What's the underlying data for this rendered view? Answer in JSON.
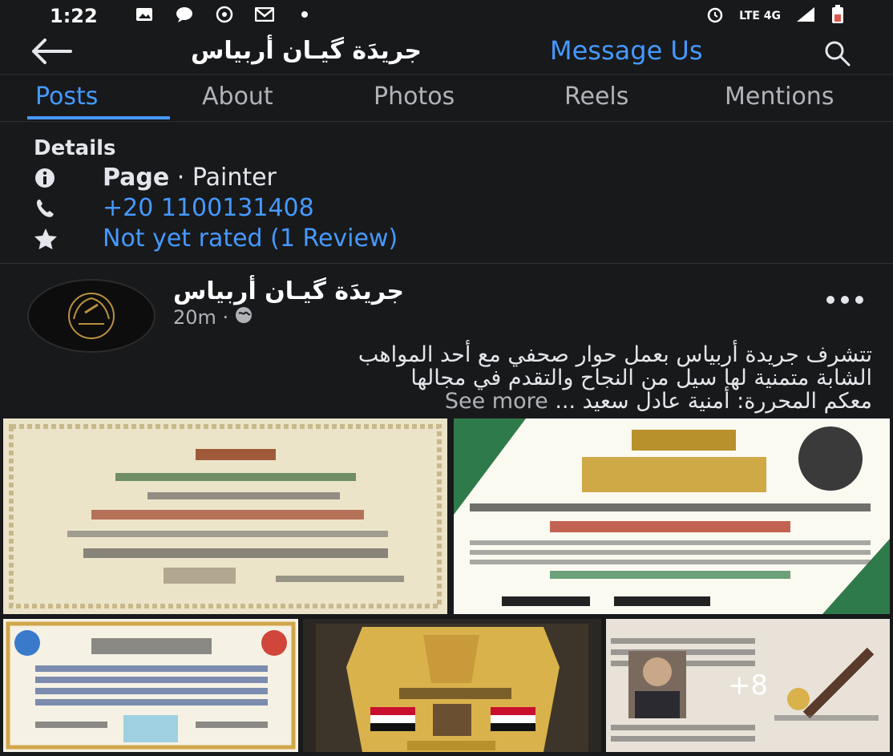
{
  "status_bar": {
    "time": "1:22",
    "right_text": "LTE 4G"
  },
  "app_bar": {
    "page_name": "جريدَة گيـان أربياس",
    "message_us": "Message Us"
  },
  "tabs": [
    "Posts",
    "About",
    "Photos",
    "Reels",
    "Mentions"
  ],
  "details": {
    "title": "Details",
    "page_bold": "Page",
    "page_category": " · Painter",
    "phone": "+20 1100131408",
    "rating": "Not yet rated (1 Review)"
  },
  "post": {
    "author": "جريدَة گيـان أربياس",
    "time": "20m ·",
    "text_line1": "تتشرف جريدة أربياس بعمل حوار صحفي مع أحد المواهب",
    "text_line2": "الشابة متمنية لها سيل من النجاح والتقدم في مجالها",
    "text_line3": "معكم المحررة: أمنية عادل سعيد ...",
    "see_more": "See more",
    "more_photos": "+8"
  },
  "colors": {
    "background": "#18191b",
    "accent": "#4599ff",
    "text": "#e4e6eb",
    "muted": "#b0b3b8"
  },
  "icons": [
    "back-arrow-icon",
    "search-icon",
    "info-icon",
    "phone-icon",
    "star-icon",
    "globe-icon",
    "more-dots-icon"
  ]
}
